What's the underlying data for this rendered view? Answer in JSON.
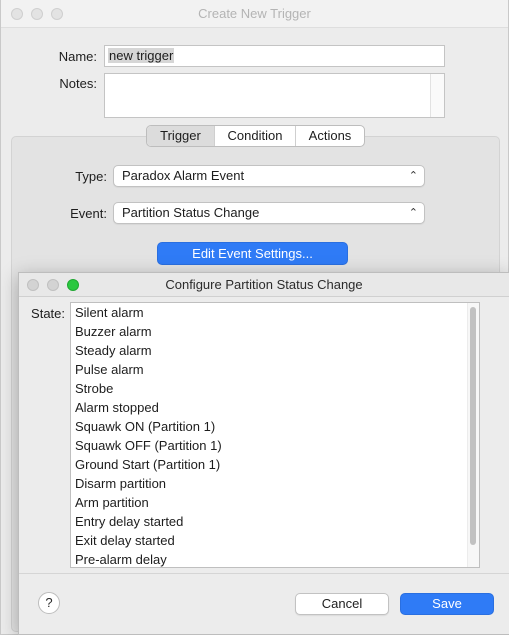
{
  "main_window": {
    "title": "Create New Trigger",
    "name_label": "Name:",
    "name_value": "new trigger",
    "notes_label": "Notes:",
    "notes_value": "",
    "tabs": [
      {
        "label": "Trigger",
        "active": true
      },
      {
        "label": "Condition",
        "active": false
      },
      {
        "label": "Actions",
        "active": false
      }
    ],
    "type_label": "Type:",
    "type_value": "Paradox Alarm Event",
    "event_label": "Event:",
    "event_value": "Partition Status Change",
    "edit_button": "Edit Event Settings..."
  },
  "config_window": {
    "title": "Configure Partition Status Change",
    "state_label": "State:",
    "states": [
      "Silent alarm",
      "Buzzer alarm",
      "Steady alarm",
      "Pulse alarm",
      "Strobe",
      "Alarm stopped",
      "Squawk ON (Partition 1)",
      "Squawk OFF (Partition 1)",
      "Ground Start (Partition 1)",
      "Disarm partition",
      "Arm partition",
      "Entry delay started",
      "Exit delay started",
      "Pre-alarm delay"
    ],
    "help_label": "?",
    "cancel_label": "Cancel",
    "save_label": "Save"
  },
  "icons": {
    "popup_chevron": "chevron-updown-icon",
    "help": "question-icon"
  },
  "colors": {
    "accent": "#2f7bf6",
    "window_bg": "#ececec",
    "traffic_green": "#2ac840"
  }
}
